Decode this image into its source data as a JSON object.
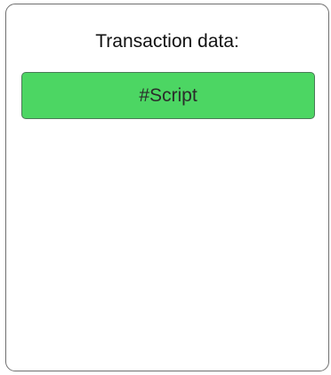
{
  "panel": {
    "title": "Transaction data:",
    "items": [
      {
        "label": "#Script",
        "color": "#4cd663"
      }
    ]
  }
}
